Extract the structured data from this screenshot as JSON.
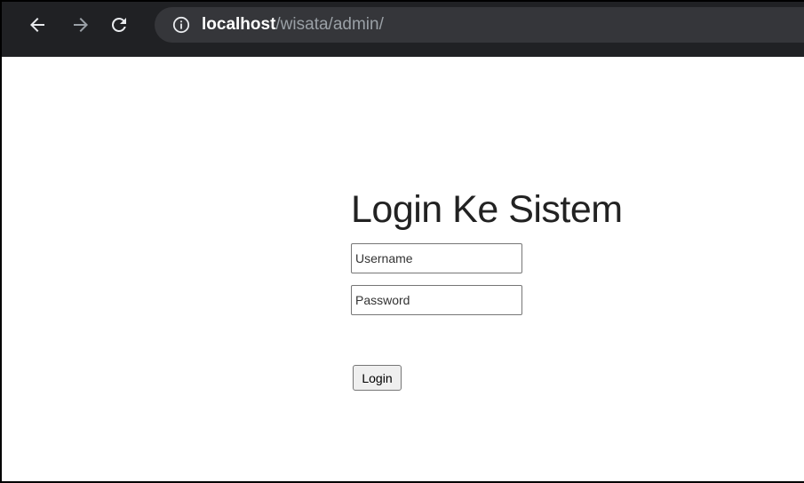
{
  "browser": {
    "url_host": "localhost",
    "url_path": "/wisata/admin/",
    "icons": [
      "back-arrow-icon",
      "forward-arrow-icon",
      "reload-icon",
      "info-icon"
    ]
  },
  "page": {
    "title": "Login Ke Sistem",
    "username_placeholder": "Username",
    "username_value": "",
    "password_placeholder": "Password",
    "password_value": "",
    "login_label": "Login"
  },
  "colors": {
    "toolbar_bg": "#202124",
    "omnibox_bg": "#35363a",
    "url_path": "#9aa0a6",
    "page_bg": "#ffffff"
  }
}
